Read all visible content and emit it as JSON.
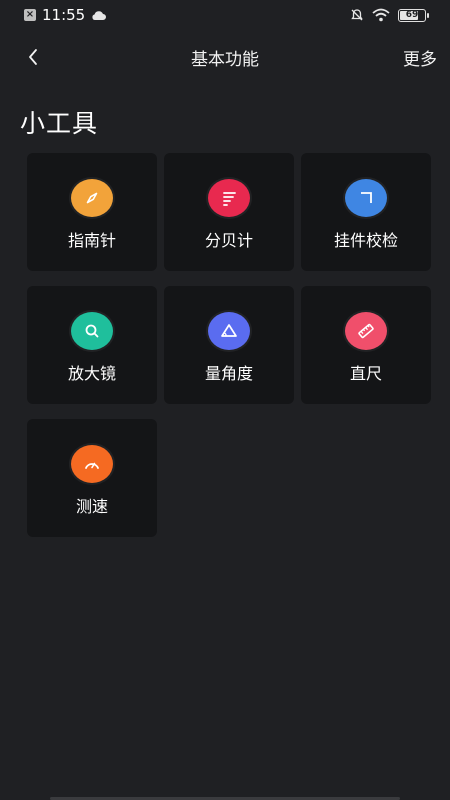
{
  "status_bar": {
    "time": "11:55",
    "battery": "69",
    "battery_level": 0.69
  },
  "nav": {
    "title": "基本功能",
    "more": "更多",
    "back_icon": "chevron-left-icon"
  },
  "section_title": "小工具",
  "tools": [
    {
      "label": "指南针",
      "icon": "compass-icon",
      "color": "#f2a33a"
    },
    {
      "label": "分贝计",
      "icon": "decibel-icon",
      "color": "#e8294f"
    },
    {
      "label": "挂件校检",
      "icon": "level-corner-icon",
      "color": "#3f86e3"
    },
    {
      "label": "放大镜",
      "icon": "magnifier-icon",
      "color": "#1fbf9c"
    },
    {
      "label": "量角度",
      "icon": "protractor-icon",
      "color": "#5a6cf0"
    },
    {
      "label": "直尺",
      "icon": "ruler-icon",
      "color": "#f04f6b"
    },
    {
      "label": "测速",
      "icon": "speedometer-icon",
      "color": "#f56a22"
    }
  ]
}
